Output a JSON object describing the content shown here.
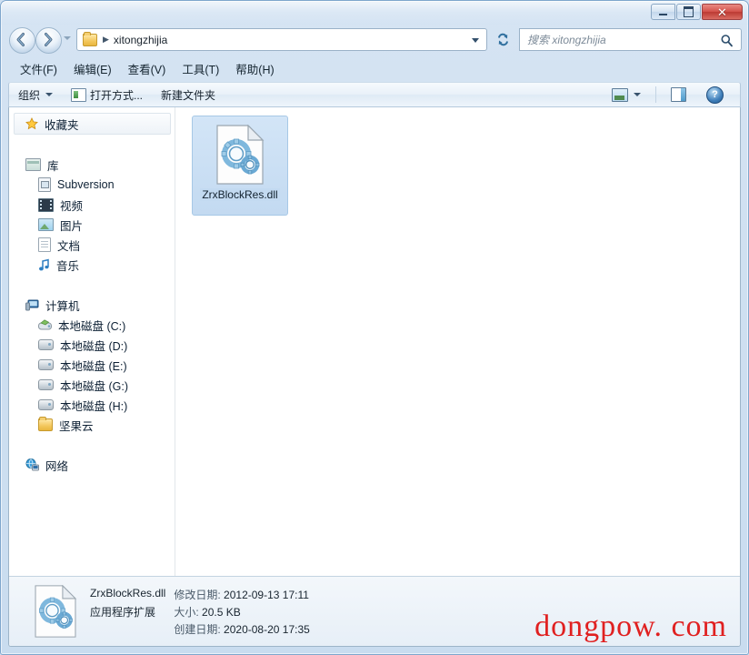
{
  "window": {
    "minimize_label": "最小化",
    "maximize_label": "最大化",
    "close_label": "✕"
  },
  "address": {
    "folder_icon": "folder-icon",
    "separator": "▶",
    "path": "xitongzhijia",
    "dropdown_icon": "chevron-down-icon",
    "refresh_icon": "refresh-icon",
    "back_icon": "back-arrow-icon",
    "forward_icon": "forward-arrow-icon"
  },
  "search": {
    "placeholder": "搜索 xitongzhijia",
    "value": "",
    "icon": "search-icon"
  },
  "menubar": {
    "items": [
      {
        "label": "文件(F)"
      },
      {
        "label": "编辑(E)"
      },
      {
        "label": "查看(V)"
      },
      {
        "label": "工具(T)"
      },
      {
        "label": "帮助(H)"
      }
    ]
  },
  "commandbar": {
    "organize": "组织",
    "open_with": "打开方式...",
    "new_folder": "新建文件夹",
    "view_icon": "view-mode-icon",
    "view_caret_icon": "chevron-down-icon",
    "preview_pane_icon": "preview-pane-icon",
    "help_icon": "help-icon",
    "help_glyph": "?"
  },
  "navpane": {
    "favorites": {
      "label": "收藏夹",
      "icon": "star-icon"
    },
    "sections": [
      {
        "label": "库",
        "icon": "library-icon",
        "items": [
          {
            "label": "Subversion",
            "icon": "subversion-icon"
          },
          {
            "label": "视频",
            "icon": "video-icon"
          },
          {
            "label": "图片",
            "icon": "pictures-icon"
          },
          {
            "label": "文档",
            "icon": "documents-icon"
          },
          {
            "label": "音乐",
            "icon": "music-icon"
          }
        ]
      },
      {
        "label": "计算机",
        "icon": "computer-icon",
        "items": [
          {
            "label": "本地磁盘 (C:)",
            "icon": "system-drive-icon"
          },
          {
            "label": "本地磁盘 (D:)",
            "icon": "drive-icon"
          },
          {
            "label": "本地磁盘 (E:)",
            "icon": "drive-icon"
          },
          {
            "label": "本地磁盘 (G:)",
            "icon": "drive-icon"
          },
          {
            "label": "本地磁盘 (H:)",
            "icon": "drive-icon"
          },
          {
            "label": "坚果云",
            "icon": "folder-icon"
          }
        ]
      },
      {
        "label": "网络",
        "icon": "network-icon",
        "items": []
      }
    ]
  },
  "files": [
    {
      "name": "ZrxBlockRes.dll",
      "icon": "dll-icon",
      "selected": true
    }
  ],
  "details": {
    "icon": "dll-icon",
    "name": "ZrxBlockRes.dll",
    "type": "应用程序扩展",
    "modified_key": "修改日期:",
    "modified_value": "2012-09-13 17:11",
    "size_key": "大小:",
    "size_value": "20.5 KB",
    "created_key": "创建日期:",
    "created_value": "2020-08-20 17:35"
  },
  "watermark": {
    "text": "dongpow. com",
    "color": "#e02020"
  },
  "colors": {
    "window_frame": "#cfe0f2",
    "selection": "#c3daf1",
    "close_button": "#d4544c",
    "content_bg": "#ffffff"
  }
}
